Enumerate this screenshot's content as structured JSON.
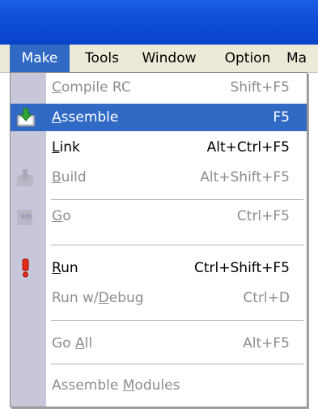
{
  "menubar": {
    "items": [
      {
        "label": "Make",
        "active": true
      },
      {
        "label": "Tools"
      },
      {
        "label": "Window"
      },
      {
        "label": "Option"
      },
      {
        "label": "Ma"
      }
    ]
  },
  "menu": {
    "items": [
      {
        "label_pre": "",
        "mnemonic": "C",
        "label_post": "ompile RC",
        "shortcut": "Shift+F5",
        "enabled": false,
        "icon": "none"
      },
      {
        "label_pre": "",
        "mnemonic": "A",
        "label_post": "ssemble",
        "shortcut": "F5",
        "enabled": true,
        "highlighted": true,
        "icon": "assemble-download-icon"
      },
      {
        "label_pre": "",
        "mnemonic": "L",
        "label_post": "ink",
        "shortcut": "Alt+Ctrl+F5",
        "enabled": true,
        "icon": "none"
      },
      {
        "label_pre": "",
        "mnemonic": "B",
        "label_post": "uild",
        "shortcut": "Alt+Shift+F5",
        "enabled": false,
        "icon": "build-icon"
      },
      {
        "label_pre": "",
        "mnemonic": "G",
        "label_post": "o",
        "shortcut": "Ctrl+F5",
        "enabled": false,
        "icon": "go-icon"
      },
      {
        "label_pre": "",
        "mnemonic": "R",
        "label_post": "un",
        "shortcut": "Ctrl+Shift+F5",
        "enabled": true,
        "icon": "exclamation-icon"
      },
      {
        "label_pre": "Run w/",
        "mnemonic": "D",
        "label_post": "ebug",
        "shortcut": "Ctrl+D",
        "enabled": false,
        "icon": "none"
      },
      {
        "label_pre": "Go ",
        "mnemonic": "A",
        "label_post": "ll",
        "shortcut": "Alt+F5",
        "enabled": false,
        "icon": "none"
      },
      {
        "label_pre": "Assemble ",
        "mnemonic": "M",
        "label_post": "odules",
        "shortcut": "",
        "enabled": false,
        "icon": "none"
      }
    ]
  },
  "colors": {
    "title_blue": "#0f4fd8",
    "highlight": "#316ac5",
    "gutter": "#c7c7d9",
    "menubar_bg": "#ece9d8",
    "disabled_text": "#8d8d8d",
    "run_icon_red": "#e52a18",
    "assemble_icon_green": "#2fa838"
  }
}
